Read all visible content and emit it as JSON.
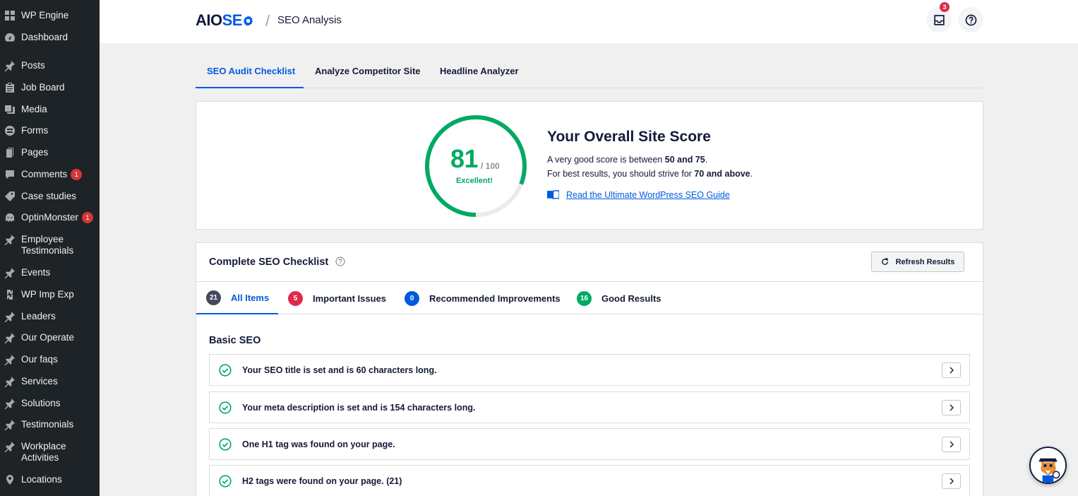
{
  "sidebar": {
    "items": [
      {
        "label": "WP Engine",
        "icon": "grid-icon"
      },
      {
        "label": "Dashboard",
        "icon": "dashboard-icon"
      },
      {
        "label": "Posts",
        "icon": "pin-icon"
      },
      {
        "label": "Job Board",
        "icon": "clipboard-icon"
      },
      {
        "label": "Media",
        "icon": "media-icon"
      },
      {
        "label": "Forms",
        "icon": "forms-icon"
      },
      {
        "label": "Pages",
        "icon": "pages-icon"
      },
      {
        "label": "Comments",
        "icon": "comment-icon",
        "badge": "1"
      },
      {
        "label": "Case studies",
        "icon": "tag-icon"
      },
      {
        "label": "OptinMonster",
        "icon": "monster-icon",
        "badge": "1"
      },
      {
        "label": "Employee Testimonials",
        "icon": "pin-icon"
      },
      {
        "label": "Events",
        "icon": "pin-icon"
      },
      {
        "label": "WP Imp Exp",
        "icon": "import-export-icon"
      },
      {
        "label": "Leaders",
        "icon": "pin-icon"
      },
      {
        "label": "Our Operate",
        "icon": "pin-icon"
      },
      {
        "label": "Our faqs",
        "icon": "pin-icon"
      },
      {
        "label": "Services",
        "icon": "pin-icon"
      },
      {
        "label": "Solutions",
        "icon": "pin-icon"
      },
      {
        "label": "Testimonials",
        "icon": "pin-icon"
      },
      {
        "label": "Workplace Activities",
        "icon": "pin-icon"
      },
      {
        "label": "Locations",
        "icon": "location-icon"
      }
    ]
  },
  "header": {
    "logo_aio": "AIO",
    "logo_seo": "SE",
    "separator": "/",
    "title": "SEO Analysis",
    "notifications_badge": "3"
  },
  "tabs": [
    "SEO Audit Checklist",
    "Analyze Competitor Site",
    "Headline Analyzer"
  ],
  "score": {
    "value": "81",
    "max": "/ 100",
    "label": "Excellent!",
    "fraction": 0.81,
    "title": "Your Overall Site Score",
    "line1_prefix": "A very good score is between ",
    "line1_bold": "50 and 75",
    "line1_suffix": ".",
    "line2_prefix": "For best results, you should strive for ",
    "line2_bold": "70 and above",
    "line2_suffix": ".",
    "guide_link": "Read the Ultimate WordPress SEO Guide",
    "color": "#00aa63"
  },
  "checklist": {
    "title": "Complete SEO Checklist",
    "refresh_label": "Refresh Results",
    "filters": [
      {
        "count": "21",
        "label": "All Items",
        "color": "#434960"
      },
      {
        "count": "5",
        "label": "Important Issues",
        "color": "#df2a4a"
      },
      {
        "count": "0",
        "label": "Recommended Improvements",
        "color": "#005ae0"
      },
      {
        "count": "16",
        "label": "Good Results",
        "color": "#00aa63"
      }
    ],
    "section_title": "Basic SEO",
    "rows": [
      "Your SEO title is set and is 60 characters long.",
      "Your meta description is set and is 154 characters long.",
      "One H1 tag was found on your page.",
      "H2 tags were found on your page. (21)"
    ]
  }
}
